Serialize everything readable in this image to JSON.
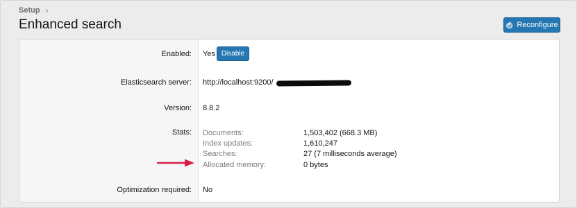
{
  "breadcrumb": {
    "item": "Setup"
  },
  "header": {
    "title": "Enhanced search",
    "reconfigure_label": "Reconfigure"
  },
  "rows": {
    "enabled": {
      "label": "Enabled:",
      "value": "Yes",
      "disable_label": "Disable"
    },
    "server": {
      "label": "Elasticsearch server:",
      "value": "http://localhost:9200/"
    },
    "version": {
      "label": "Version:",
      "value": "8.8.2"
    },
    "stats": {
      "label": "Stats:",
      "items": [
        {
          "label": "Documents:",
          "value": "1,503,402 (668.3 MB)"
        },
        {
          "label": "Index updates:",
          "value": "1,610,247"
        },
        {
          "label": "Searches:",
          "value": "27 (7 milliseconds average)"
        },
        {
          "label": "Allocated memory:",
          "value": "0 bytes"
        }
      ]
    },
    "optimization": {
      "label": "Optimization required:",
      "value": "No"
    }
  },
  "icons": {
    "reconfigure": "gear-icon",
    "annotation": "red-arrow-icon",
    "breadcrumb_separator": "chevron-right-icon"
  },
  "colors": {
    "accent": "#2577b1",
    "annotation": "#d81e4a",
    "redaction": "#0c0c0c"
  }
}
